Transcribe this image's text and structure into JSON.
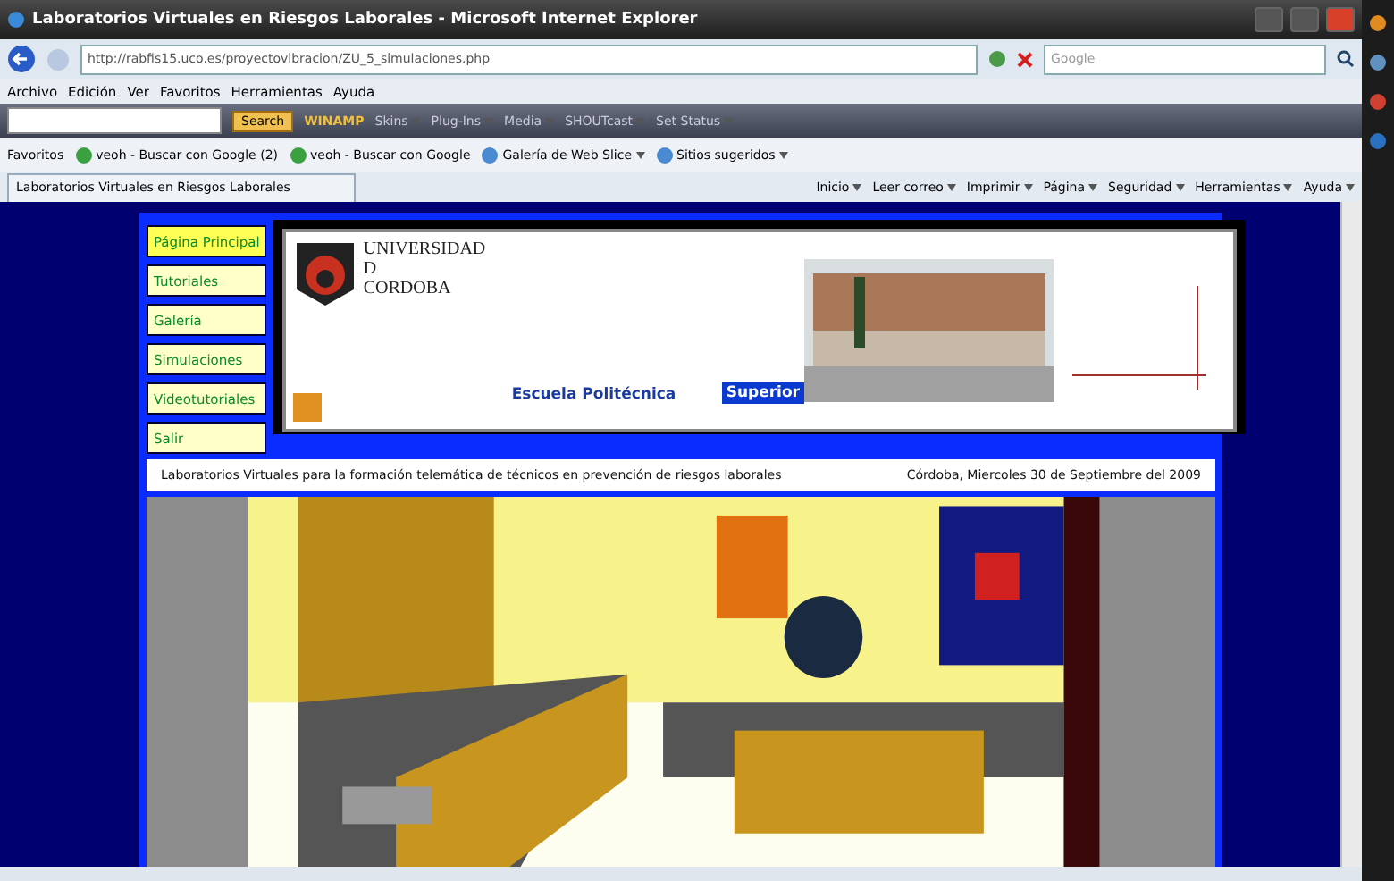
{
  "window": {
    "title": "Laboratorios Virtuales en Riesgos Laborales - Microsoft Internet Explorer"
  },
  "address": {
    "url": "http://rabfis15.uco.es/proyectovibracion/ZU_5_simulaciones.php",
    "search_placeholder": "Google"
  },
  "menu": [
    "Archivo",
    "Edición",
    "Ver",
    "Favoritos",
    "Herramientas",
    "Ayuda"
  ],
  "toolbar": {
    "search_button": "Search",
    "items": [
      {
        "label": "WINAMP",
        "kind": "brand"
      },
      {
        "label": "Skins",
        "kind": "menu"
      },
      {
        "label": "Plug-Ins",
        "kind": "menu"
      },
      {
        "label": "Media",
        "kind": "menu"
      },
      {
        "label": "SHOUTcast",
        "kind": "menu"
      },
      {
        "label": "Set Status",
        "kind": "status"
      }
    ]
  },
  "favorites": {
    "label": "Favoritos",
    "items": [
      {
        "label": "veoh - Buscar con Google (2)",
        "kind": "google"
      },
      {
        "label": "veoh - Buscar con Google",
        "kind": "google"
      },
      {
        "label": "Galería de Web Slice",
        "kind": "dropdown"
      },
      {
        "label": "Sitios sugeridos",
        "kind": "dropdown"
      }
    ]
  },
  "tab": {
    "title": "Laboratorios Virtuales en Riesgos Laborales"
  },
  "command_bar": [
    "Inicio",
    "Leer correo",
    "Imprimir",
    "Página",
    "Seguridad",
    "Herramientas",
    "Ayuda"
  ],
  "page": {
    "nav": [
      {
        "label": "Página Principal",
        "selected": true
      },
      {
        "label": "Tutoriales",
        "selected": false
      },
      {
        "label": "Galería",
        "selected": false
      },
      {
        "label": "Simulaciones",
        "selected": false
      },
      {
        "label": "Videotutoriales",
        "selected": false
      },
      {
        "label": "Salir",
        "selected": false
      }
    ],
    "logo_lines": [
      "UNIVERSIDAD",
      "D",
      "CORDOBA"
    ],
    "school": "Escuela Politécnica",
    "school_highlight": "Superior",
    "subtitle": "Laboratorios Virtuales para la formación telemática de técnicos en prevención de riesgos laborales",
    "date": "Córdoba, Miercoles 30 de Septiembre del 2009",
    "scene": {
      "kind": "picture"
    }
  }
}
